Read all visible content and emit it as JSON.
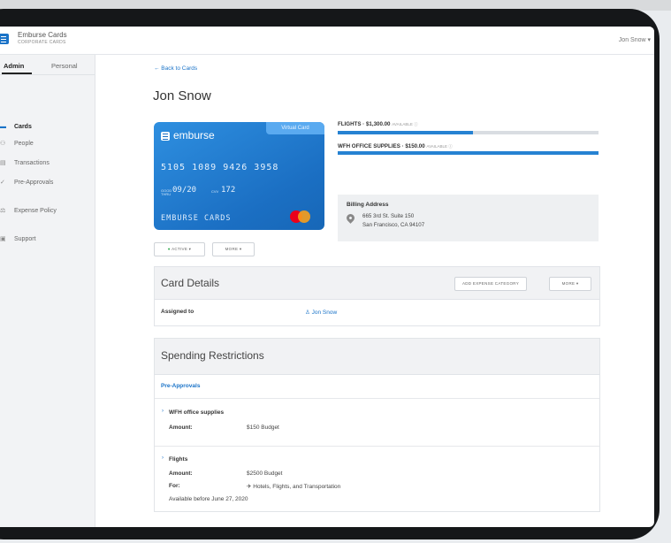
{
  "header": {
    "app_name": "Emburse Cards",
    "app_subtitle": "CORPORATE CARDS",
    "user": "Jon Snow ▾"
  },
  "sidebar": {
    "tabs": [
      {
        "label": "Admin"
      },
      {
        "label": "Personal"
      }
    ],
    "items": [
      {
        "label": "Cards",
        "icon": "card-icon",
        "glyph": "▬"
      },
      {
        "label": "People",
        "icon": "people-icon",
        "glyph": "⚇"
      },
      {
        "label": "Transactions",
        "icon": "transactions-icon",
        "glyph": "▤"
      },
      {
        "label": "Pre-Approvals",
        "icon": "pre-approvals-icon",
        "glyph": "✓"
      },
      {
        "label": "Expense Policy",
        "icon": "policy-icon",
        "glyph": "⚖"
      },
      {
        "label": "Support",
        "icon": "support-icon",
        "glyph": "▣"
      }
    ]
  },
  "main": {
    "back_link": "← Back to Cards",
    "title": "Jon Snow",
    "card": {
      "brand": "emburse",
      "type_badge": "Virtual Card",
      "number": "5105 1089 9426 3958",
      "good_thru": "GOOD THRU",
      "expiry": "09/20",
      "cvv_label": "CVV",
      "cvv": "172",
      "name": "EMBURSE CARDS"
    },
    "budgets": [
      {
        "label": "FLIGHTS · $1,300.00",
        "available": "AVAILABLE ⓘ",
        "fill": 0.52
      },
      {
        "label": "WFH OFFICE SUPPLIES · $150.00",
        "available": "AVAILABLE ⓘ",
        "fill": 1.0
      }
    ],
    "billing": {
      "title": "Billing Address",
      "line1": "665 3rd St. Suite 150",
      "line2": "San Francisco, CA 94107"
    },
    "buttons": {
      "active": "ACTIVE ▾",
      "active_dot": "●",
      "more": "MORE ▾"
    },
    "card_details": {
      "title": "Card Details",
      "add_category": "ADD EXPENSE CATEGORY",
      "more": "MORE ▾",
      "assigned_label": "Assigned to",
      "assigned_value": "♙ Jon Snow"
    },
    "spending": {
      "title": "Spending Restrictions",
      "pre_approvals": "Pre-Approvals",
      "chevron": "›",
      "items": [
        {
          "name": "WFH office supplies",
          "amount_label": "Amount:",
          "amount": "$150 Budget"
        },
        {
          "name": "Flights",
          "amount_label": "Amount:",
          "amount": "$2500 Budget",
          "for_label": "For:",
          "for_value": "✈ Hotels, Flights, and Transportation",
          "note": "Available before June 27, 2020"
        }
      ]
    }
  },
  "colors": {
    "accent": "#1a73c8",
    "card": "#1b6fc3",
    "bar": "#2682d2"
  }
}
